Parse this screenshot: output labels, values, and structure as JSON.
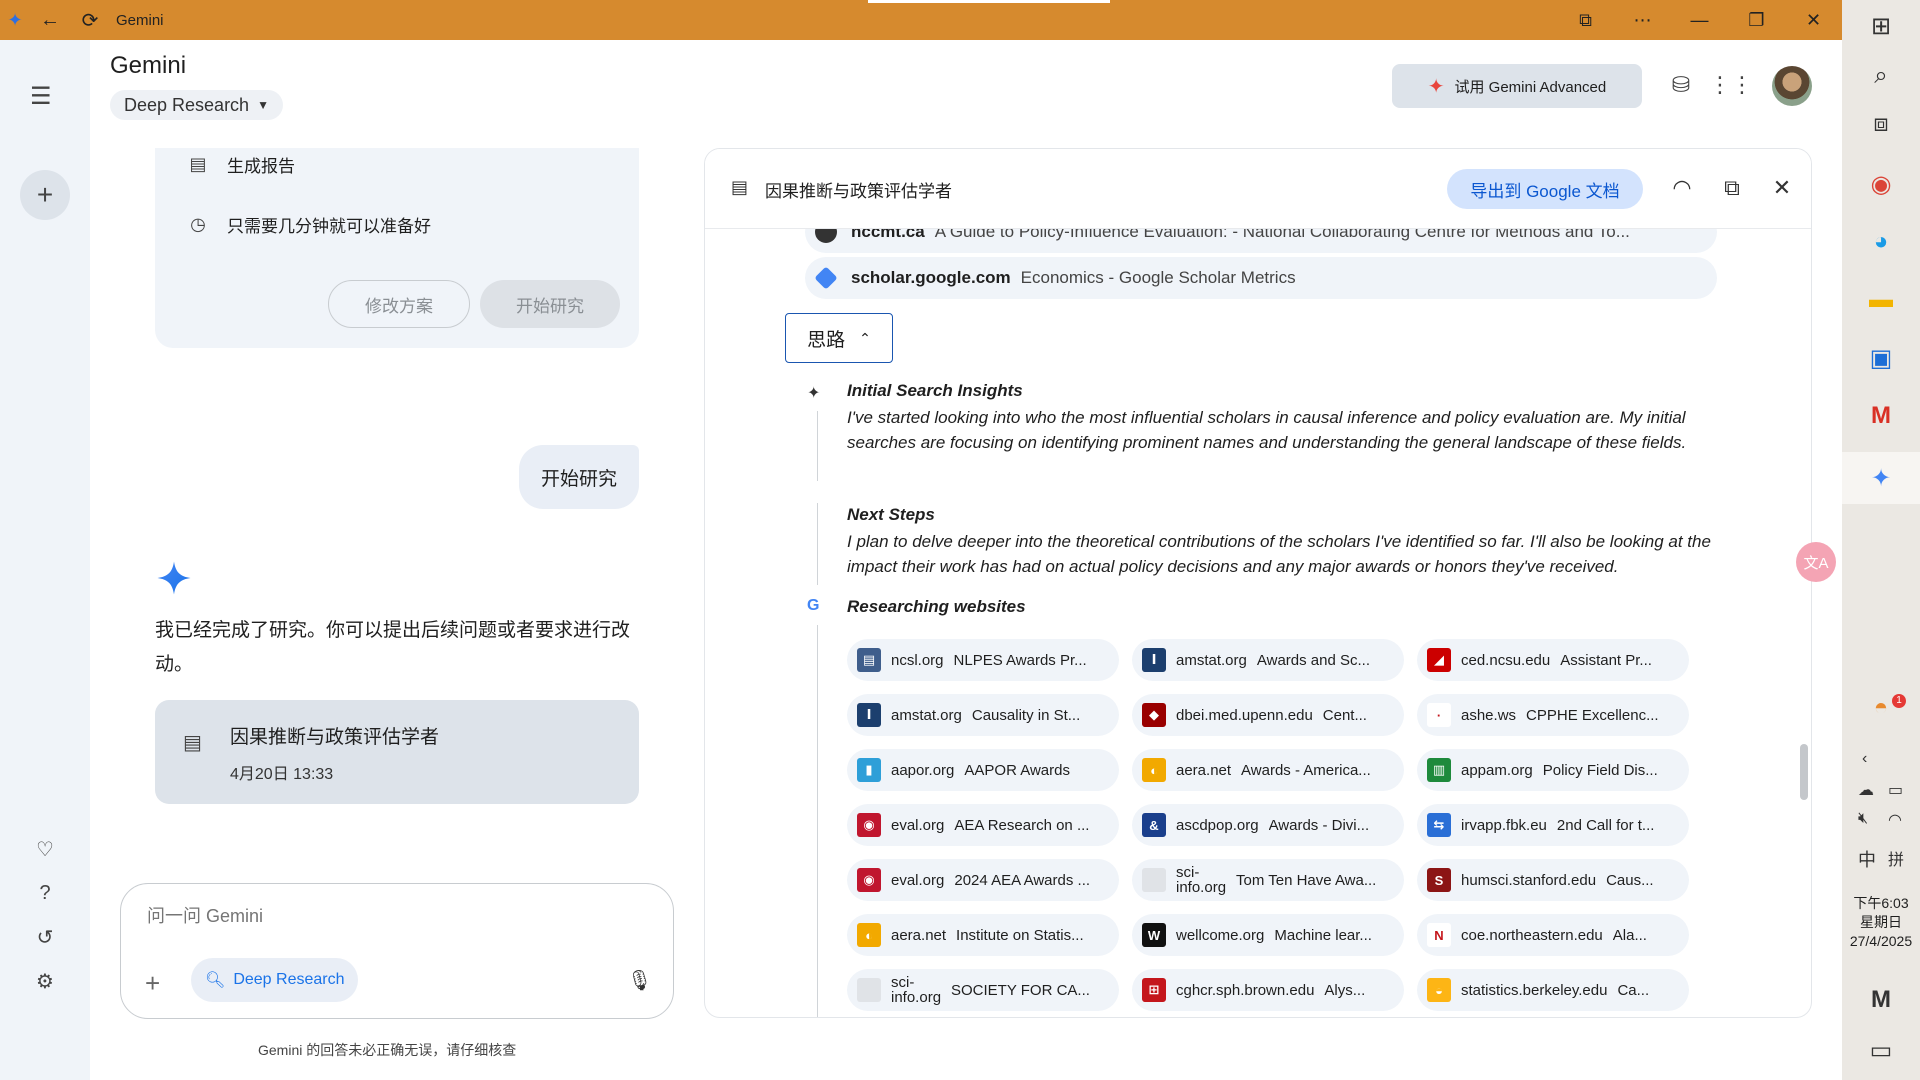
{
  "titlebar": {
    "title": "Gemini"
  },
  "header": {
    "title": "Gemini",
    "model": "Deep Research",
    "advanced_button": "试用 Gemini Advanced"
  },
  "plan_card": {
    "row1": "生成报告",
    "row2": "只需要几分钟就可以准备好",
    "edit_button": "修改方案",
    "start_button": "开始研究"
  },
  "user_message": "开始研究",
  "reply": "我已经完成了研究。你可以提出后续问题或者要求进行改动。",
  "doc_card": {
    "title": "因果推断与政策评估学者",
    "date": "4月20日 13:33"
  },
  "input": {
    "placeholder": "问一问 Gemini",
    "tool": "Deep Research"
  },
  "disclaimer": "Gemini 的回答未必正确无误，请仔细核查",
  "panel": {
    "title": "因果推断与政策评估学者",
    "export_button": "导出到 Google 文档",
    "sources": [
      {
        "domain": "nccmt.ca",
        "title": "A Guide to Policy-Influence Evaluation: - National Collaborating Centre for Methods and To..."
      },
      {
        "domain": "scholar.google.com",
        "title": "Economics - Google Scholar Metrics"
      }
    ],
    "thinking_toggle": "思路",
    "thoughts": [
      {
        "heading": "Initial Search Insights",
        "body": "I've started looking into who the most influential scholars in causal inference and policy evaluation are. My initial searches are focusing on identifying prominent names and understanding the general landscape of these fields."
      },
      {
        "heading": "Next Steps",
        "body": "I plan to delve deeper into the theoretical contributions of the scholars I've identified so far. I'll also be looking at the impact their work has had on actual policy decisions and any major awards or honors they've received."
      }
    ],
    "researching_heading": "Researching websites",
    "websites": [
      {
        "domain": "ncsl.org",
        "title": "NLPES Awards Pr...",
        "color": "#3f5e8c",
        "glyph": "▤"
      },
      {
        "domain": "amstat.org",
        "title": "Awards and Sc...",
        "color": "#1c3f6e",
        "glyph": "Ⅰ"
      },
      {
        "domain": "ced.ncsu.edu",
        "title": "Assistant Pr...",
        "color": "#cc0000",
        "glyph": "◢"
      },
      {
        "domain": "amstat.org",
        "title": "Causality in St...",
        "color": "#1c3f6e",
        "glyph": "Ⅰ"
      },
      {
        "domain": "dbei.med.upenn.edu",
        "title": "Cent...",
        "color": "#990000",
        "glyph": "◆"
      },
      {
        "domain": "ashe.ws",
        "title": "CPPHE Excellenc...",
        "color": "#ffffff",
        "glyph": "·"
      },
      {
        "domain": "aapor.org",
        "title": "AAPOR Awards",
        "color": "#2e9fd8",
        "glyph": "▮"
      },
      {
        "domain": "aera.net",
        "title": "Awards - America...",
        "color": "#f2a900",
        "glyph": "◐"
      },
      {
        "domain": "appam.org",
        "title": "Policy Field Dis...",
        "color": "#1e8a3c",
        "glyph": "▥"
      },
      {
        "domain": "eval.org",
        "title": "AEA Research on ...",
        "color": "#c0162e",
        "glyph": "◉"
      },
      {
        "domain": "ascdpop.org",
        "title": "Awards - Divi...",
        "color": "#1a3f8c",
        "glyph": "&"
      },
      {
        "domain": "irvapp.fbk.eu",
        "title": "2nd Call for t...",
        "color": "#2a6fd6",
        "glyph": "⇆"
      },
      {
        "domain": "eval.org",
        "title": "2024 AEA Awards ...",
        "color": "#c0162e",
        "glyph": "◉"
      },
      {
        "domain": "sci-info.org",
        "title": "Tom Ten Have Awa...",
        "color": "#e0e3e7",
        "glyph": ""
      },
      {
        "domain": "humsci.stanford.edu",
        "title": "Caus...",
        "color": "#8c1515",
        "glyph": "S"
      },
      {
        "domain": "aera.net",
        "title": "Institute on Statis...",
        "color": "#f2a900",
        "glyph": "◐"
      },
      {
        "domain": "wellcome.org",
        "title": "Machine lear...",
        "color": "#111111",
        "glyph": "W"
      },
      {
        "domain": "coe.northeastern.edu",
        "title": "Ala...",
        "color": "#ffffff",
        "glyph": "N"
      },
      {
        "domain": "sci-info.org",
        "title": "SOCIETY FOR CA...",
        "color": "#e0e3e7",
        "glyph": ""
      },
      {
        "domain": "cghcr.sph.brown.edu",
        "title": "Alys...",
        "color": "#c4161c",
        "glyph": "⊞"
      },
      {
        "domain": "statistics.berkeley.edu",
        "title": "Ca...",
        "color": "#fdb515",
        "glyph": "◒"
      }
    ]
  },
  "taskbar": {
    "ime": "中",
    "ime2": "拼",
    "time": "下午6:03",
    "weekday": "星期日",
    "date": "27/4/2025",
    "badge": "1"
  }
}
